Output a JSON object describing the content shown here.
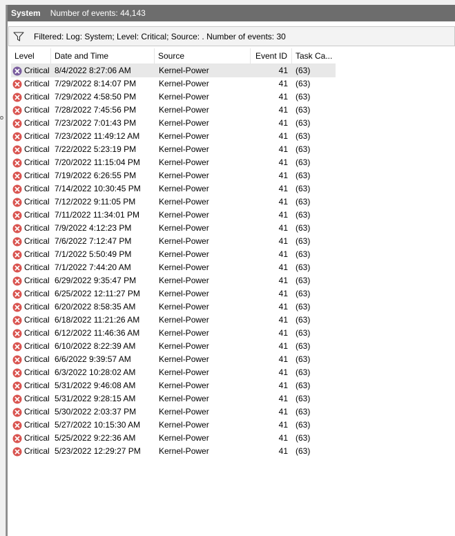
{
  "panel": {
    "title": "System",
    "event_count": "Number of events: 44,143"
  },
  "filter": {
    "text": "Filtered: Log: System; Level: Critical; Source: . Number of events: 30"
  },
  "columns": {
    "level": "Level",
    "date_time": "Date and Time",
    "source": "Source",
    "event_id": "Event ID",
    "task_category": "Task Ca..."
  },
  "colors": {
    "title_bar": "#6d6d6d",
    "error_icon": "#d9534f",
    "error_icon_selected": "#7a5c9e",
    "selected_row": "#e8e8e8"
  },
  "icons": {
    "filter": "funnel-icon",
    "level": "critical-error-icon"
  },
  "events": [
    {
      "level": "Critical",
      "date": "8/4/2022 8:27:06 AM",
      "source": "Kernel-Power",
      "id": "41",
      "task": "(63)"
    },
    {
      "level": "Critical",
      "date": "7/29/2022 8:14:07 PM",
      "source": "Kernel-Power",
      "id": "41",
      "task": "(63)"
    },
    {
      "level": "Critical",
      "date": "7/29/2022 4:58:50 PM",
      "source": "Kernel-Power",
      "id": "41",
      "task": "(63)"
    },
    {
      "level": "Critical",
      "date": "7/28/2022 7:45:56 PM",
      "source": "Kernel-Power",
      "id": "41",
      "task": "(63)"
    },
    {
      "level": "Critical",
      "date": "7/23/2022 7:01:43 PM",
      "source": "Kernel-Power",
      "id": "41",
      "task": "(63)"
    },
    {
      "level": "Critical",
      "date": "7/23/2022 11:49:12 AM",
      "source": "Kernel-Power",
      "id": "41",
      "task": "(63)"
    },
    {
      "level": "Critical",
      "date": "7/22/2022 5:23:19 PM",
      "source": "Kernel-Power",
      "id": "41",
      "task": "(63)"
    },
    {
      "level": "Critical",
      "date": "7/20/2022 11:15:04 PM",
      "source": "Kernel-Power",
      "id": "41",
      "task": "(63)"
    },
    {
      "level": "Critical",
      "date": "7/19/2022 6:26:55 PM",
      "source": "Kernel-Power",
      "id": "41",
      "task": "(63)"
    },
    {
      "level": "Critical",
      "date": "7/14/2022 10:30:45 PM",
      "source": "Kernel-Power",
      "id": "41",
      "task": "(63)"
    },
    {
      "level": "Critical",
      "date": "7/12/2022 9:11:05 PM",
      "source": "Kernel-Power",
      "id": "41",
      "task": "(63)"
    },
    {
      "level": "Critical",
      "date": "7/11/2022 11:34:01 PM",
      "source": "Kernel-Power",
      "id": "41",
      "task": "(63)"
    },
    {
      "level": "Critical",
      "date": "7/9/2022 4:12:23 PM",
      "source": "Kernel-Power",
      "id": "41",
      "task": "(63)"
    },
    {
      "level": "Critical",
      "date": "7/6/2022 7:12:47 PM",
      "source": "Kernel-Power",
      "id": "41",
      "task": "(63)"
    },
    {
      "level": "Critical",
      "date": "7/1/2022 5:50:49 PM",
      "source": "Kernel-Power",
      "id": "41",
      "task": "(63)"
    },
    {
      "level": "Critical",
      "date": "7/1/2022 7:44:20 AM",
      "source": "Kernel-Power",
      "id": "41",
      "task": "(63)"
    },
    {
      "level": "Critical",
      "date": "6/29/2022 9:35:47 PM",
      "source": "Kernel-Power",
      "id": "41",
      "task": "(63)"
    },
    {
      "level": "Critical",
      "date": "6/25/2022 12:11:27 PM",
      "source": "Kernel-Power",
      "id": "41",
      "task": "(63)"
    },
    {
      "level": "Critical",
      "date": "6/20/2022 8:58:35 AM",
      "source": "Kernel-Power",
      "id": "41",
      "task": "(63)"
    },
    {
      "level": "Critical",
      "date": "6/18/2022 11:21:26 AM",
      "source": "Kernel-Power",
      "id": "41",
      "task": "(63)"
    },
    {
      "level": "Critical",
      "date": "6/12/2022 11:46:36 AM",
      "source": "Kernel-Power",
      "id": "41",
      "task": "(63)"
    },
    {
      "level": "Critical",
      "date": "6/10/2022 8:22:39 AM",
      "source": "Kernel-Power",
      "id": "41",
      "task": "(63)"
    },
    {
      "level": "Critical",
      "date": "6/6/2022 9:39:57 AM",
      "source": "Kernel-Power",
      "id": "41",
      "task": "(63)"
    },
    {
      "level": "Critical",
      "date": "6/3/2022 10:28:02 AM",
      "source": "Kernel-Power",
      "id": "41",
      "task": "(63)"
    },
    {
      "level": "Critical",
      "date": "5/31/2022 9:46:08 AM",
      "source": "Kernel-Power",
      "id": "41",
      "task": "(63)"
    },
    {
      "level": "Critical",
      "date": "5/31/2022 9:28:15 AM",
      "source": "Kernel-Power",
      "id": "41",
      "task": "(63)"
    },
    {
      "level": "Critical",
      "date": "5/30/2022 2:03:37 PM",
      "source": "Kernel-Power",
      "id": "41",
      "task": "(63)"
    },
    {
      "level": "Critical",
      "date": "5/27/2022 10:15:30 AM",
      "source": "Kernel-Power",
      "id": "41",
      "task": "(63)"
    },
    {
      "level": "Critical",
      "date": "5/25/2022 9:22:36 AM",
      "source": "Kernel-Power",
      "id": "41",
      "task": "(63)"
    },
    {
      "level": "Critical",
      "date": "5/23/2022 12:29:27 PM",
      "source": "Kernel-Power",
      "id": "41",
      "task": "(63)"
    }
  ]
}
